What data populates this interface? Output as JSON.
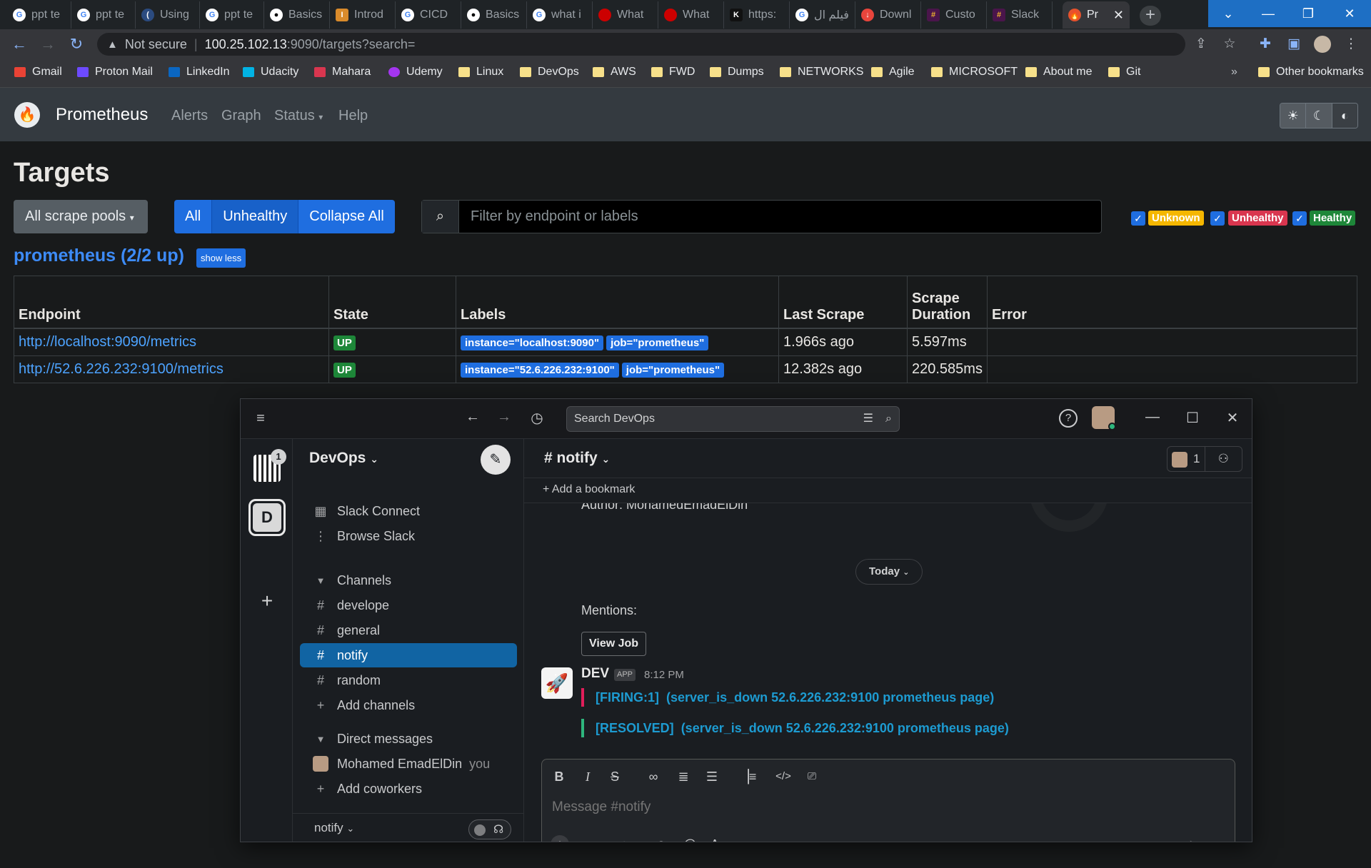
{
  "browser": {
    "tabs": [
      {
        "label": "ppt te",
        "icon": "google-icon"
      },
      {
        "label": "ppt te",
        "icon": "google-icon"
      },
      {
        "label": "Using",
        "icon": "site-icon"
      },
      {
        "label": "ppt te",
        "icon": "google-icon"
      },
      {
        "label": "Basics",
        "icon": "medium-icon"
      },
      {
        "label": "Introd",
        "icon": "site-icon"
      },
      {
        "label": "CICD",
        "icon": "google-icon"
      },
      {
        "label": "Basics",
        "icon": "medium-icon"
      },
      {
        "label": "what i",
        "icon": "google-icon"
      },
      {
        "label": "What",
        "icon": "redhat-icon"
      },
      {
        "label": "What",
        "icon": "redhat-icon"
      },
      {
        "label": "https:",
        "icon": "site-icon"
      },
      {
        "label": "فيلم ال",
        "icon": "google-icon"
      },
      {
        "label": "Downl",
        "icon": "site-icon"
      },
      {
        "label": "Custo",
        "icon": "slack-icon"
      },
      {
        "label": "Slack",
        "icon": "slack-icon"
      },
      {
        "label": "Pr",
        "icon": "prometheus-icon"
      }
    ],
    "address": {
      "security": "Not secure",
      "host": "100.25.102.13",
      "path": ":9090/targets?search="
    },
    "bookmarks": [
      "Gmail",
      "Proton Mail",
      "LinkedIn",
      "Udacity",
      "Mahara",
      "Udemy",
      "Linux",
      "DevOps",
      "AWS",
      "FWD",
      "Dumps",
      "NETWORKS",
      "Agile",
      "MICROSOFT",
      "About me",
      "Git"
    ],
    "bookmarks_more": "»",
    "other_bookmarks": "Other bookmarks"
  },
  "prometheus": {
    "brand": "Prometheus",
    "nav": [
      "Alerts",
      "Graph",
      "Status",
      "Help"
    ],
    "page_title": "Targets",
    "pool_select": "All scrape pools",
    "filters": [
      "All",
      "Unhealthy",
      "Collapse All"
    ],
    "search_placeholder": "Filter by endpoint or labels",
    "health_badges": [
      {
        "label": "Unknown",
        "color": "#f5b700"
      },
      {
        "label": "Unhealthy",
        "color": "#d9364f"
      },
      {
        "label": "Healthy",
        "color": "#1e8739"
      }
    ],
    "pool_title": "prometheus (2/2 up)",
    "show_less": "show less",
    "columns": [
      "Endpoint",
      "State",
      "Labels",
      "Last Scrape",
      "Scrape Duration",
      "Error"
    ],
    "rows": [
      {
        "endpoint": "http://localhost:9090/metrics",
        "state": "UP",
        "labels": [
          "instance=\"localhost:9090\"",
          "job=\"prometheus\""
        ],
        "last_scrape": "1.966s ago",
        "duration": "5.597ms",
        "error": ""
      },
      {
        "endpoint": "http://52.6.226.232:9100/metrics",
        "state": "UP",
        "labels": [
          "instance=\"52.6.226.232:9100\"",
          "job=\"prometheus\""
        ],
        "last_scrape": "12.382s ago",
        "duration": "220.585ms",
        "error": ""
      }
    ]
  },
  "slack": {
    "search_placeholder": "Search DevOps",
    "workspace_badge": "1",
    "workspace_letter": "D",
    "workspace_name": "DevOps",
    "sidebar": {
      "slack_connect": "Slack Connect",
      "browse": "Browse Slack",
      "channels_header": "Channels",
      "channels": [
        "develope",
        "general",
        "notify",
        "random"
      ],
      "active_channel": "notify",
      "add_channels": "Add channels",
      "dm_header": "Direct messages",
      "dm_user": "Mohamed EmadElDin",
      "dm_you": "you",
      "add_coworkers": "Add coworkers",
      "footer": "notify"
    },
    "channel": {
      "name": "notify",
      "member_count": "1",
      "add_bookmark": "Add a bookmark",
      "author_line": "Author: MohamedEmadElDin",
      "today": "Today",
      "mentions": "Mentions:",
      "view_job": "View Job",
      "app_name": "DEV",
      "app_tag": "APP",
      "time": "8:12 PM",
      "alerts": [
        {
          "tag": "[FIRING:1]",
          "text": "(server_is_down 52.6.226.232:9100 prometheus page)",
          "color": "#e01e5a"
        },
        {
          "tag": "[RESOLVED]",
          "text": "(server_is_down 52.6.226.232:9100 prometheus page)",
          "color": "#2eb67d"
        }
      ],
      "composer_placeholder": "Message #notify"
    }
  }
}
